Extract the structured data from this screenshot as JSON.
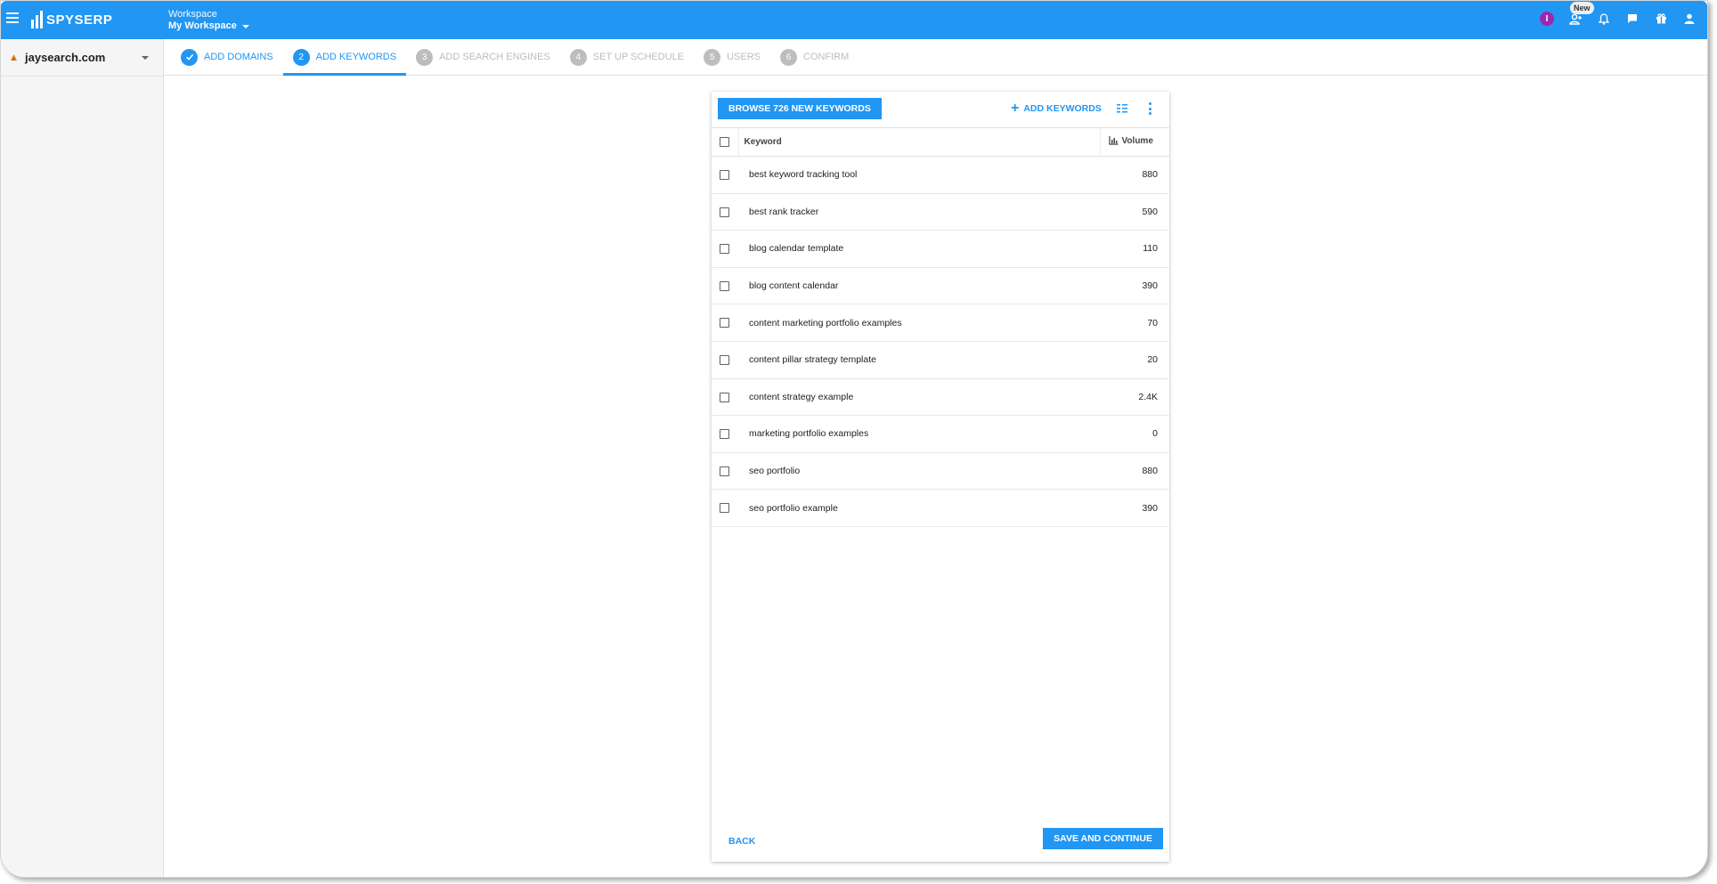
{
  "app": {
    "logo_text": "SPYSERP"
  },
  "workspace": {
    "label": "Workspace",
    "name": "My Workspace"
  },
  "topbar": {
    "avatar_letter": "I",
    "new_badge": "New"
  },
  "sidebar": {
    "domain": "jaysearch.com"
  },
  "steps": [
    {
      "num": "✓",
      "label": "ADD DOMAINS"
    },
    {
      "num": "2",
      "label": "ADD KEYWORDS"
    },
    {
      "num": "3",
      "label": "ADD SEARCH ENGINES"
    },
    {
      "num": "4",
      "label": "SET UP SCHEDULE"
    },
    {
      "num": "5",
      "label": "USERS"
    },
    {
      "num": "6",
      "label": "CONFIRM"
    }
  ],
  "toolbar": {
    "browse_label": "BROWSE 726 NEW KEYWORDS",
    "add_label": "ADD KEYWORDS"
  },
  "table": {
    "col_keyword": "Keyword",
    "col_volume": "Volume",
    "rows": [
      {
        "keyword": "best keyword tracking tool",
        "volume": "880"
      },
      {
        "keyword": "best rank tracker",
        "volume": "590"
      },
      {
        "keyword": "blog calendar template",
        "volume": "110"
      },
      {
        "keyword": "blog content calendar",
        "volume": "390"
      },
      {
        "keyword": "content marketing portfolio examples",
        "volume": "70"
      },
      {
        "keyword": "content pillar strategy template",
        "volume": "20"
      },
      {
        "keyword": "content strategy example",
        "volume": "2.4K"
      },
      {
        "keyword": "marketing portfolio examples",
        "volume": "0"
      },
      {
        "keyword": "seo portfolio",
        "volume": "880"
      },
      {
        "keyword": "seo portfolio example",
        "volume": "390"
      }
    ]
  },
  "footer": {
    "back_label": "BACK",
    "save_label": "SAVE AND CONTINUE"
  },
  "colors": {
    "primary": "#2196f3",
    "avatar": "#9c27b0",
    "inactive": "#bdbdbd"
  }
}
